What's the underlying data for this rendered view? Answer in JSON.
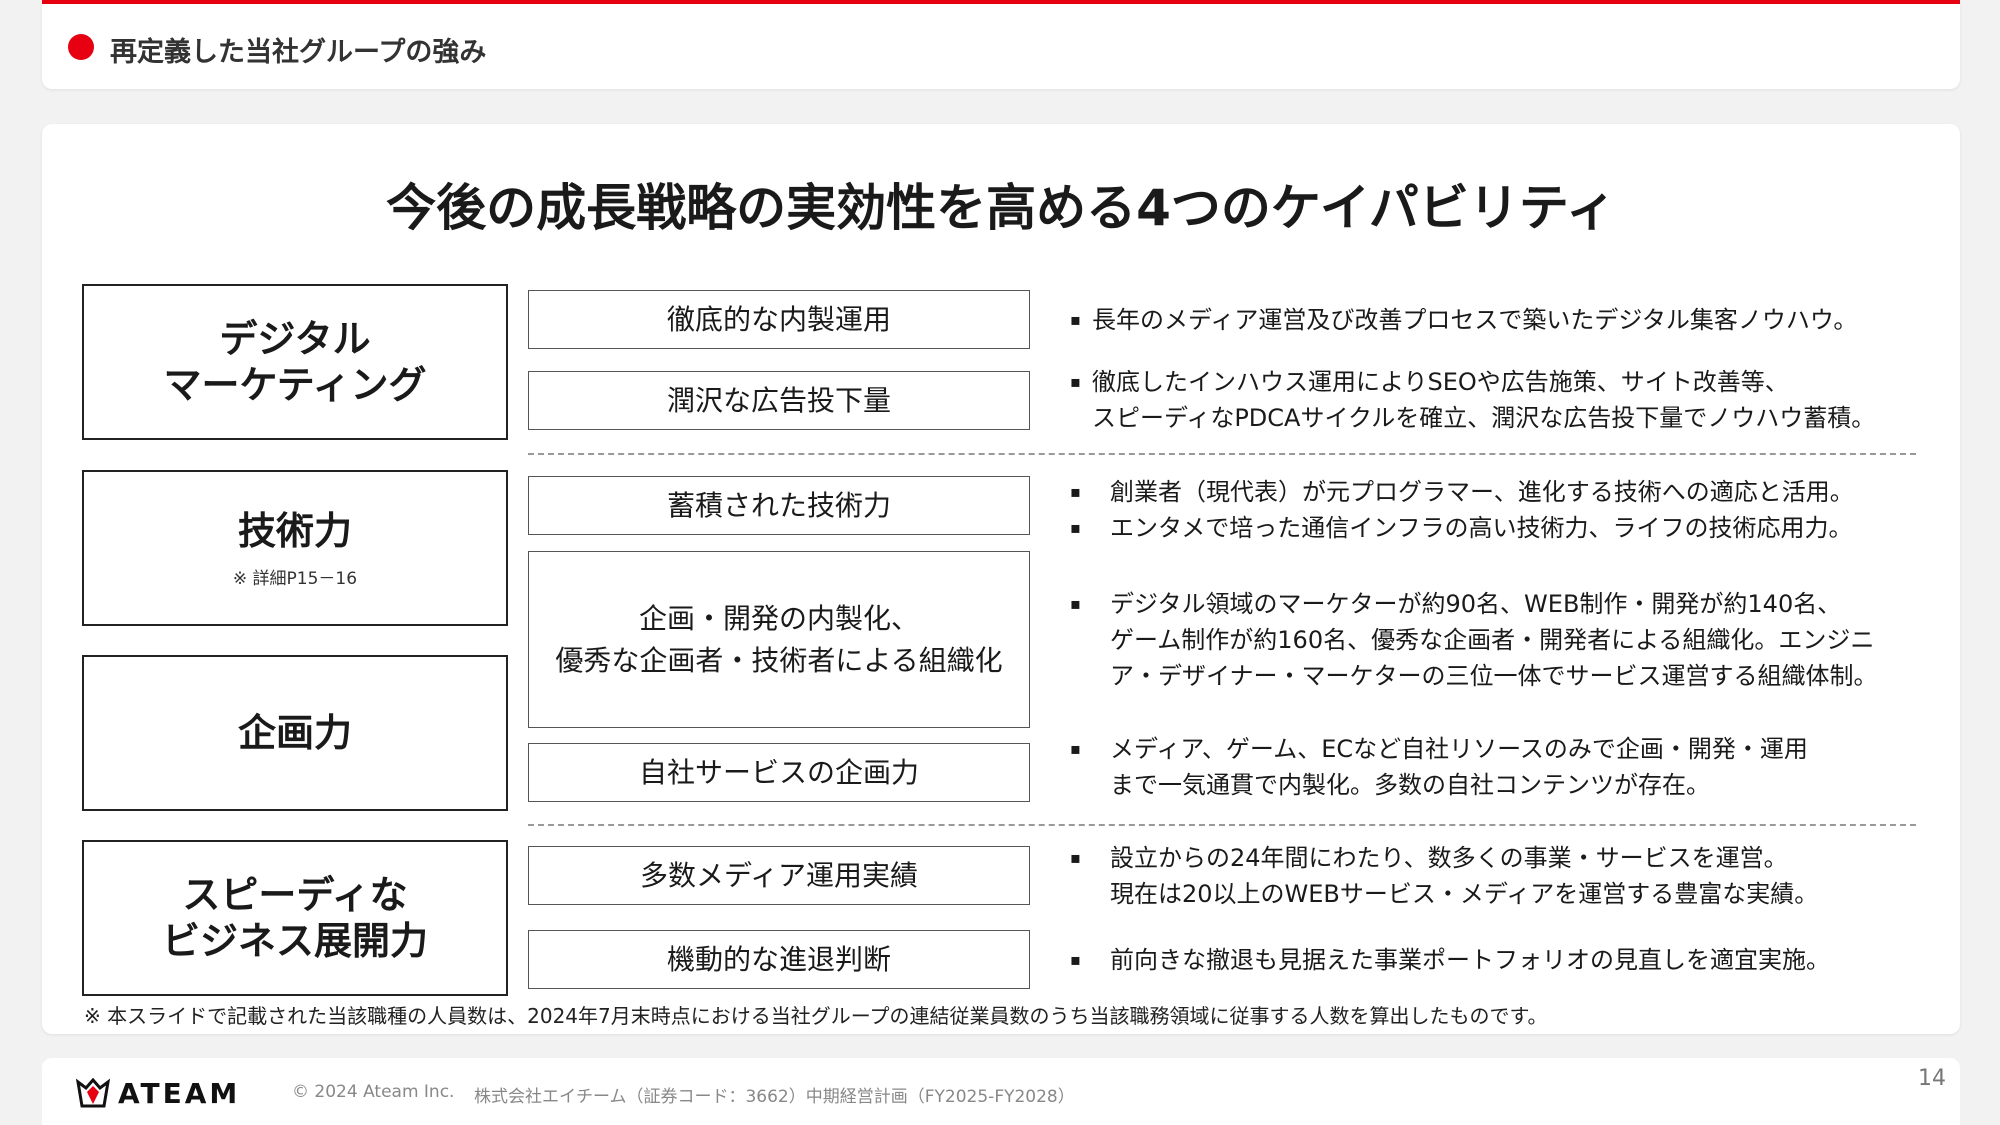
{
  "header": {
    "title": "再定義した当社グループの強み"
  },
  "main": {
    "title": "今後の成長戦略の実効性を高める4つのケイパビリティ",
    "capabilities": [
      {
        "name": "デジタル\nマーケティング",
        "note": ""
      },
      {
        "name": "技術力",
        "note": "※ 詳細P15－16"
      },
      {
        "name": "企画力",
        "note": ""
      },
      {
        "name": "スピーディな\nビジネス展開力",
        "note": ""
      }
    ],
    "sub_items": [
      "徹底的な内製運用",
      "潤沢な広告投下量",
      "蓄積された技術力",
      "企画・開発の内製化、\n優秀な企画者・技術者による組織化",
      "自社サービスの企画力",
      "多数メディア運用実績",
      "機動的な進退判断"
    ],
    "descriptions": [
      "長年のメディア運営及び改善プロセスで築いたデジタル集客ノウハウ。",
      "徹底したインハウス運用によりSEOや広告施策、サイト改善等、\nスピーディなPDCAサイクルを確立、潤沢な広告投下量でノウハウ蓄積。",
      "創業者（現代表）が元プログラマー、進化する技術への適応と活用。",
      "エンタメで培った通信インフラの高い技術力、ライフの技術応用力。",
      "デジタル領域のマーケターが約90名、WEB制作・開発が約140名、\nゲーム制作が約160名、優秀な企画者・開発者による組織化。エンジニ\nア・デザイナー・マーケターの三位一体でサービス運営する組織体制。",
      "メディア、ゲーム、ECなど自社リソースのみで企画・開発・運用\nまで一気通貫で内製化。多数の自社コンテンツが存在。",
      "設立からの24年間にわたり、数多くの事業・サービスを運営。\n現在は20以上のWEBサービス・メディアを運営する豊富な実績。",
      "前向きな撤退も見据えた事業ポートフォリオの見直しを適宜実施。"
    ],
    "bullet": "▪",
    "footnote": "※ 本スライドで記載された当該職種の人員数は、2024年7月末時点における当社グループの連結従業員数のうち当該職務領域に従事する人数を算出したものです。"
  },
  "footer": {
    "logo_text": "ATEAM",
    "copyright": "© 2024 Ateam Inc.",
    "company": "株式会社エイチーム（証券コード：3662）中期経営計画（FY2025-FY2028）",
    "page_number": "14"
  },
  "colors": {
    "accent": "#e60012"
  }
}
